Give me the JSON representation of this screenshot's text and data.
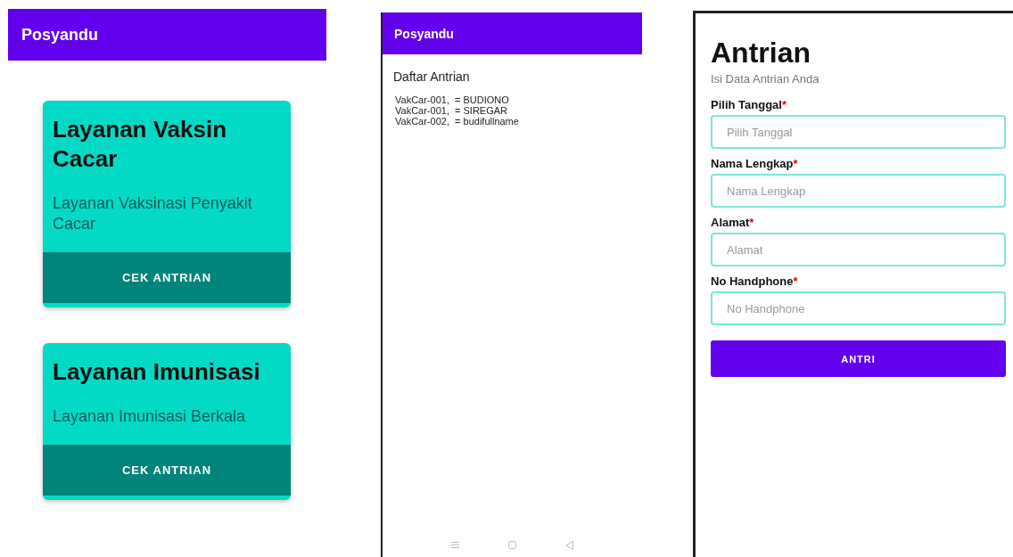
{
  "screens": [
    {
      "kind": "services",
      "app_bar": {
        "title": "Posyandu"
      },
      "cards": [
        {
          "title": "Layanan Vaksin Cacar",
          "description": "Layanan Vaksinasi Penyakit Cacar",
          "button": "CEK ANTRIAN"
        },
        {
          "title": "Layanan Imunisasi",
          "description": "Layanan Imunisasi Berkala",
          "button": "CEK ANTRIAN"
        }
      ]
    },
    {
      "kind": "queue_list",
      "app_bar": {
        "title": "Posyandu"
      },
      "heading": "Daftar Antrian",
      "entries": [
        "VakCar-001,  = BUDIONO",
        "VakCar-001,  = SIREGAR",
        "VakCar-002,  = budifullname"
      ]
    },
    {
      "kind": "form",
      "title": "Antrian",
      "subtitle": "Isi Data Antrian Anda",
      "fields": [
        {
          "label": "Pilih Tanggal",
          "required_mark": "*",
          "placeholder": "Pilih Tanggal"
        },
        {
          "label": "Nama Lengkap",
          "required_mark": "*",
          "placeholder": "Nama Lengkap"
        },
        {
          "label": "Alamat",
          "required_mark": "*",
          "placeholder": "Alamat"
        },
        {
          "label": "No Handphone",
          "required_mark": "*",
          "placeholder": "No Handphone"
        }
      ],
      "submit": "ANTRI"
    }
  ]
}
